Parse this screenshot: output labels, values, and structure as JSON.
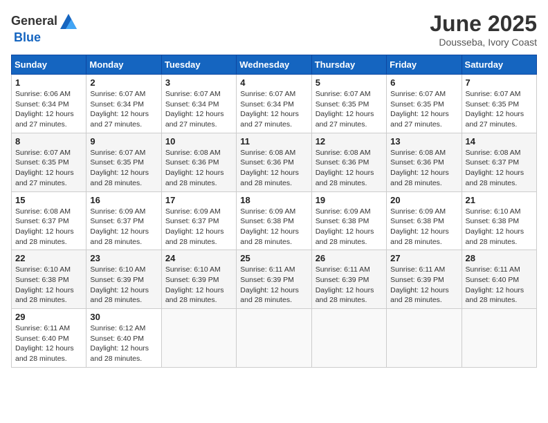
{
  "header": {
    "logo_general": "General",
    "logo_blue": "Blue",
    "month": "June 2025",
    "location": "Dousseba, Ivory Coast"
  },
  "days_of_week": [
    "Sunday",
    "Monday",
    "Tuesday",
    "Wednesday",
    "Thursday",
    "Friday",
    "Saturday"
  ],
  "weeks": [
    [
      {
        "day": "1",
        "sunrise": "6:06 AM",
        "sunset": "6:34 PM",
        "daylight": "12 hours and 27 minutes."
      },
      {
        "day": "2",
        "sunrise": "6:07 AM",
        "sunset": "6:34 PM",
        "daylight": "12 hours and 27 minutes."
      },
      {
        "day": "3",
        "sunrise": "6:07 AM",
        "sunset": "6:34 PM",
        "daylight": "12 hours and 27 minutes."
      },
      {
        "day": "4",
        "sunrise": "6:07 AM",
        "sunset": "6:34 PM",
        "daylight": "12 hours and 27 minutes."
      },
      {
        "day": "5",
        "sunrise": "6:07 AM",
        "sunset": "6:35 PM",
        "daylight": "12 hours and 27 minutes."
      },
      {
        "day": "6",
        "sunrise": "6:07 AM",
        "sunset": "6:35 PM",
        "daylight": "12 hours and 27 minutes."
      },
      {
        "day": "7",
        "sunrise": "6:07 AM",
        "sunset": "6:35 PM",
        "daylight": "12 hours and 27 minutes."
      }
    ],
    [
      {
        "day": "8",
        "sunrise": "6:07 AM",
        "sunset": "6:35 PM",
        "daylight": "12 hours and 27 minutes."
      },
      {
        "day": "9",
        "sunrise": "6:07 AM",
        "sunset": "6:35 PM",
        "daylight": "12 hours and 28 minutes."
      },
      {
        "day": "10",
        "sunrise": "6:08 AM",
        "sunset": "6:36 PM",
        "daylight": "12 hours and 28 minutes."
      },
      {
        "day": "11",
        "sunrise": "6:08 AM",
        "sunset": "6:36 PM",
        "daylight": "12 hours and 28 minutes."
      },
      {
        "day": "12",
        "sunrise": "6:08 AM",
        "sunset": "6:36 PM",
        "daylight": "12 hours and 28 minutes."
      },
      {
        "day": "13",
        "sunrise": "6:08 AM",
        "sunset": "6:36 PM",
        "daylight": "12 hours and 28 minutes."
      },
      {
        "day": "14",
        "sunrise": "6:08 AM",
        "sunset": "6:37 PM",
        "daylight": "12 hours and 28 minutes."
      }
    ],
    [
      {
        "day": "15",
        "sunrise": "6:08 AM",
        "sunset": "6:37 PM",
        "daylight": "12 hours and 28 minutes."
      },
      {
        "day": "16",
        "sunrise": "6:09 AM",
        "sunset": "6:37 PM",
        "daylight": "12 hours and 28 minutes."
      },
      {
        "day": "17",
        "sunrise": "6:09 AM",
        "sunset": "6:37 PM",
        "daylight": "12 hours and 28 minutes."
      },
      {
        "day": "18",
        "sunrise": "6:09 AM",
        "sunset": "6:38 PM",
        "daylight": "12 hours and 28 minutes."
      },
      {
        "day": "19",
        "sunrise": "6:09 AM",
        "sunset": "6:38 PM",
        "daylight": "12 hours and 28 minutes."
      },
      {
        "day": "20",
        "sunrise": "6:09 AM",
        "sunset": "6:38 PM",
        "daylight": "12 hours and 28 minutes."
      },
      {
        "day": "21",
        "sunrise": "6:10 AM",
        "sunset": "6:38 PM",
        "daylight": "12 hours and 28 minutes."
      }
    ],
    [
      {
        "day": "22",
        "sunrise": "6:10 AM",
        "sunset": "6:38 PM",
        "daylight": "12 hours and 28 minutes."
      },
      {
        "day": "23",
        "sunrise": "6:10 AM",
        "sunset": "6:39 PM",
        "daylight": "12 hours and 28 minutes."
      },
      {
        "day": "24",
        "sunrise": "6:10 AM",
        "sunset": "6:39 PM",
        "daylight": "12 hours and 28 minutes."
      },
      {
        "day": "25",
        "sunrise": "6:11 AM",
        "sunset": "6:39 PM",
        "daylight": "12 hours and 28 minutes."
      },
      {
        "day": "26",
        "sunrise": "6:11 AM",
        "sunset": "6:39 PM",
        "daylight": "12 hours and 28 minutes."
      },
      {
        "day": "27",
        "sunrise": "6:11 AM",
        "sunset": "6:39 PM",
        "daylight": "12 hours and 28 minutes."
      },
      {
        "day": "28",
        "sunrise": "6:11 AM",
        "sunset": "6:40 PM",
        "daylight": "12 hours and 28 minutes."
      }
    ],
    [
      {
        "day": "29",
        "sunrise": "6:11 AM",
        "sunset": "6:40 PM",
        "daylight": "12 hours and 28 minutes."
      },
      {
        "day": "30",
        "sunrise": "6:12 AM",
        "sunset": "6:40 PM",
        "daylight": "12 hours and 28 minutes."
      },
      null,
      null,
      null,
      null,
      null
    ]
  ]
}
